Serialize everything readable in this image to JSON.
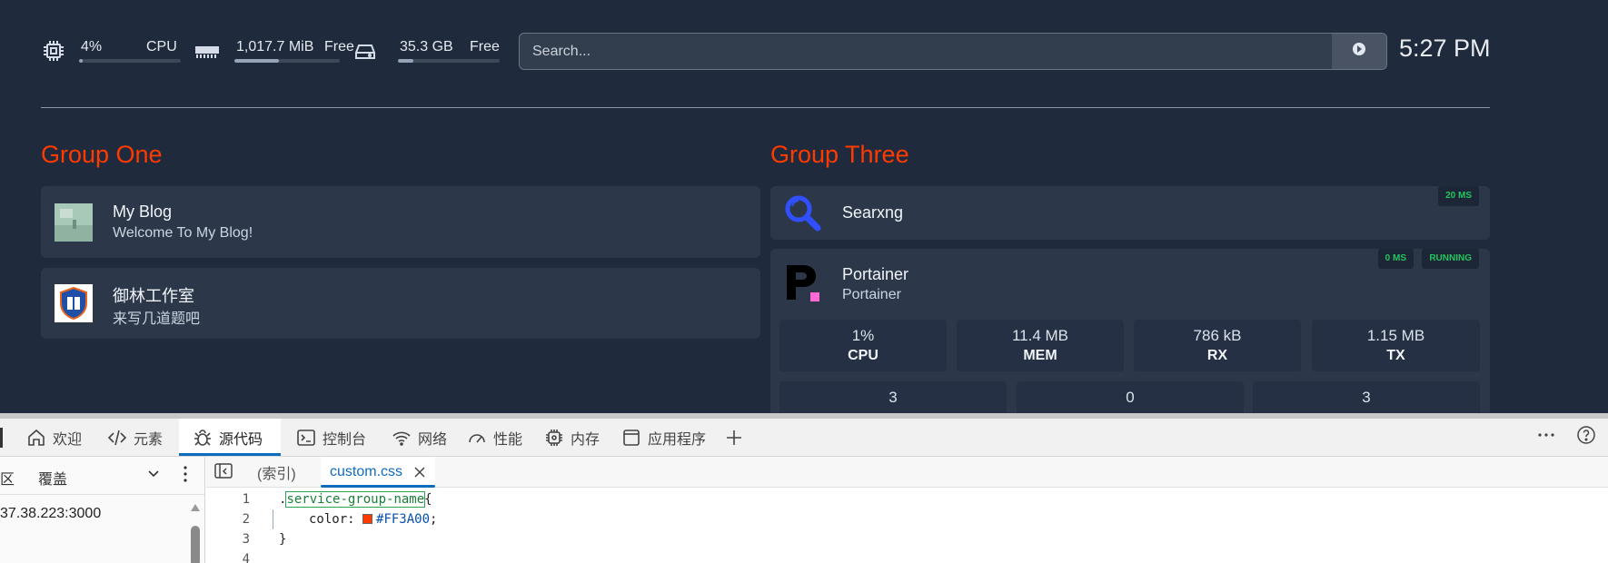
{
  "widgets": {
    "cpu": {
      "value": "4%",
      "label": "CPU",
      "level": 0.04
    },
    "memory": {
      "value": "1,017.7 MiB",
      "label": "Free",
      "level": 0.42
    },
    "disk": {
      "value": "35.3 GB",
      "label": "Free",
      "level": 0.15
    }
  },
  "search": {
    "placeholder": "Search..."
  },
  "clock": "5:27 PM",
  "groups": [
    {
      "title": "Group One",
      "services": [
        {
          "name": "My Blog",
          "description": "Welcome To My Blog!"
        },
        {
          "name": "御林工作室",
          "description": "来写几道题吧"
        }
      ]
    },
    {
      "title": "Group Three",
      "services": [
        {
          "name": "Searxng",
          "badges": [
            "20 MS"
          ]
        },
        {
          "name": "Portainer",
          "description": "Portainer",
          "badges": [
            "0 MS",
            "RUNNING"
          ],
          "stats": [
            {
              "value": "1%",
              "label": "CPU"
            },
            {
              "value": "11.4 MB",
              "label": "MEM"
            },
            {
              "value": "786 kB",
              "label": "RX"
            },
            {
              "value": "1.15 MB",
              "label": "TX"
            }
          ],
          "stats2": [
            "3",
            "0",
            "3"
          ]
        }
      ]
    }
  ],
  "devtools": {
    "tabs": [
      {
        "label": "欢迎",
        "icon": "home-icon"
      },
      {
        "label": "元素",
        "icon": "code-icon"
      },
      {
        "label": "源代码",
        "icon": "bug-icon",
        "active": true
      },
      {
        "label": "控制台",
        "icon": "console-icon"
      },
      {
        "label": "网络",
        "icon": "wifi-icon"
      },
      {
        "label": "性能",
        "icon": "gauge-icon"
      },
      {
        "label": "内存",
        "icon": "chip-icon"
      },
      {
        "label": "应用程序",
        "icon": "window-icon"
      }
    ],
    "left_panel": {
      "tab1": "区",
      "tab2": "覆盖",
      "tree_item": "37.38.223:3000"
    },
    "editor_tabs": {
      "index": "(索引)",
      "file": "custom.css"
    },
    "code": {
      "line_numbers": [
        "1",
        "2",
        "3",
        "4"
      ],
      "selector": "service-group-name",
      "property": "color",
      "value": "#FF3A00"
    }
  }
}
